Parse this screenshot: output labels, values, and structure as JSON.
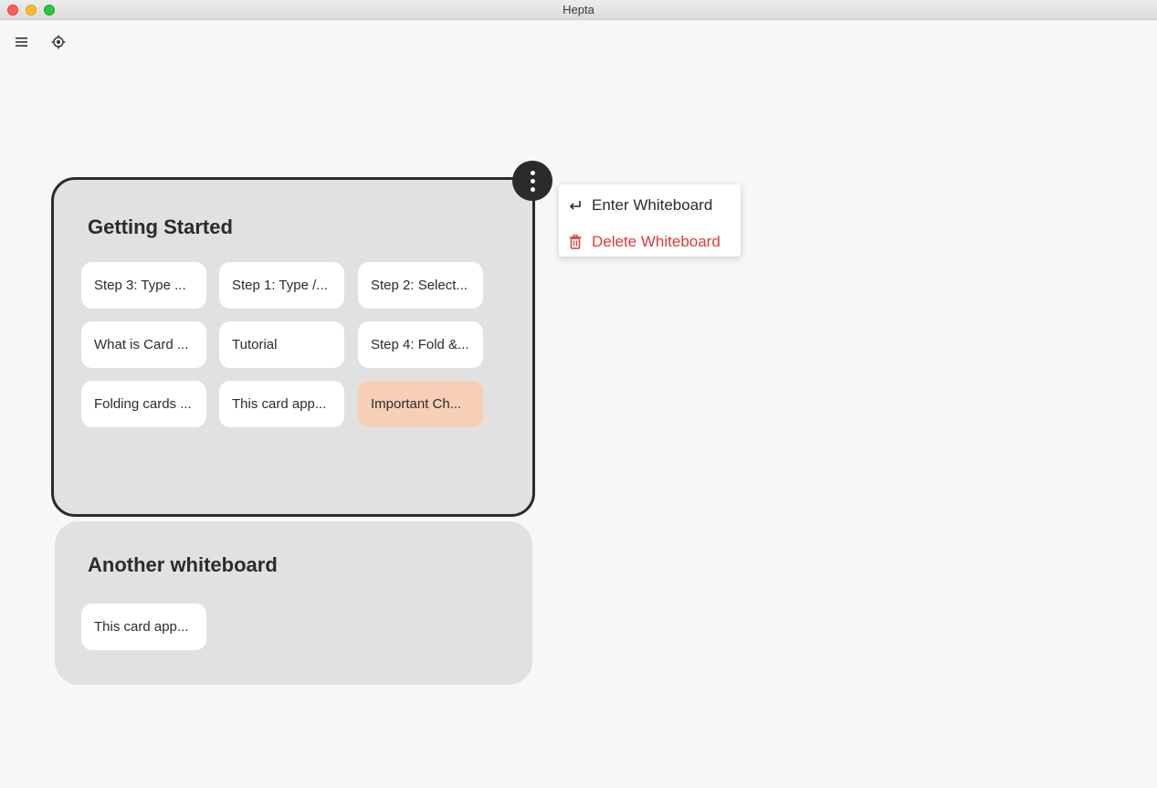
{
  "window": {
    "title": "Hepta"
  },
  "toolbar": {
    "icons": [
      "menu-icon",
      "locate-icon"
    ]
  },
  "boards": [
    {
      "title": "Getting Started",
      "selected": true,
      "cards": [
        {
          "label": "Step 3: Type ..."
        },
        {
          "label": "Step 1: Type /..."
        },
        {
          "label": "Step 2: Select..."
        },
        {
          "label": "What is Card ..."
        },
        {
          "label": "Tutorial"
        },
        {
          "label": "Step 4: Fold &..."
        },
        {
          "label": "Folding cards ..."
        },
        {
          "label": "This card app..."
        },
        {
          "label": "Important Ch...",
          "highlight": true
        }
      ]
    },
    {
      "title": "Another whiteboard",
      "selected": false,
      "cards": [
        {
          "label": "This card app..."
        }
      ]
    }
  ],
  "context_menu": {
    "items": [
      {
        "label": "Enter Whiteboard",
        "icon": "enter-icon"
      },
      {
        "label": "Delete Whiteboard",
        "icon": "trash-icon",
        "color": "#d93b3b"
      }
    ]
  },
  "colors": {
    "board_bg": "#e1e1e1",
    "highlight_card": "#f6cfb6",
    "danger": "#d93b3b",
    "selected_border": "#2b2b2b"
  }
}
